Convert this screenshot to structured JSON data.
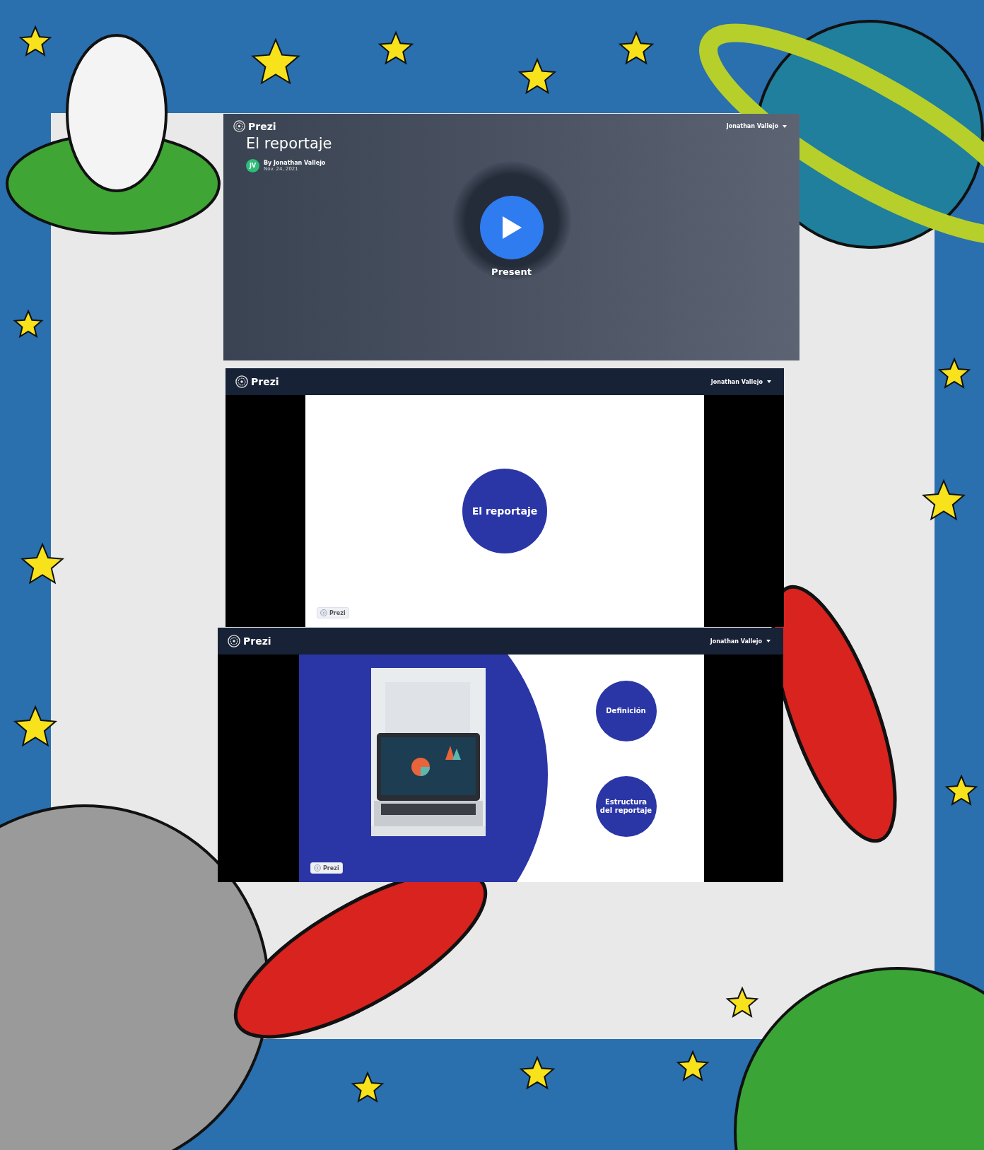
{
  "screens": [
    {
      "kind": "cover",
      "brand": "Prezi",
      "user": "Jonathan Vallejo",
      "title": "El reportaje",
      "avatar": "JV",
      "author": "By Jonathan Vallejo",
      "date": "Nov. 24, 2021",
      "play_label": "Present"
    },
    {
      "kind": "title_slide",
      "brand": "Prezi",
      "user": "Jonathan Vallejo",
      "badge": "Prezi",
      "circles": [
        "El reportaje"
      ]
    },
    {
      "kind": "split_slide",
      "brand": "Prezi",
      "user": "Jonathan Vallejo",
      "badge": "Prezi",
      "circles": [
        "Definición",
        "Estructura del reportaje"
      ]
    }
  ]
}
